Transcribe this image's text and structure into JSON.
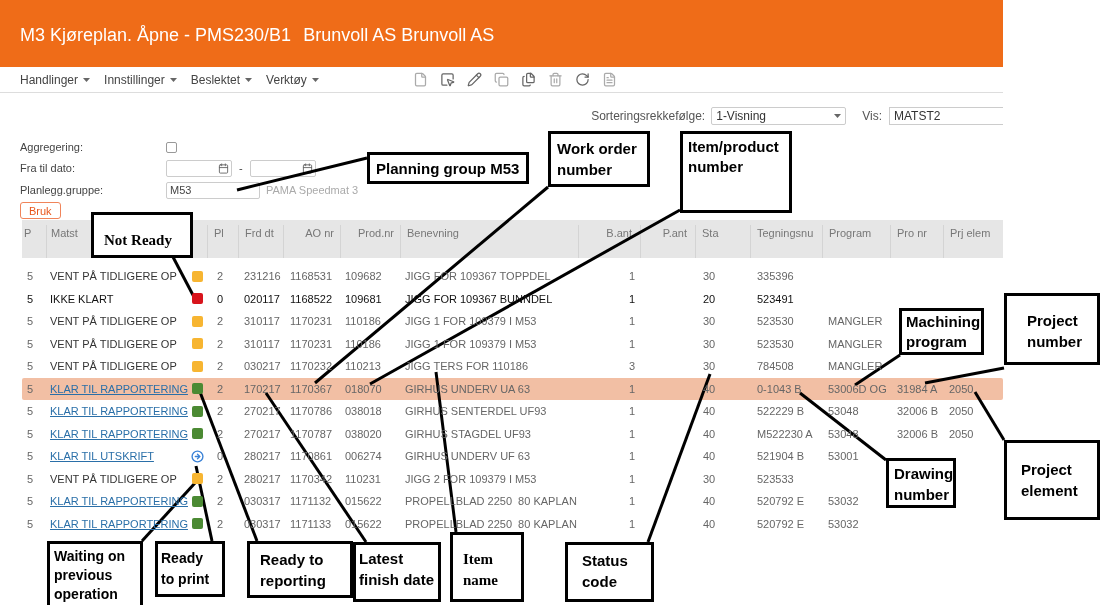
{
  "window": {
    "title": "M3 Kjøreplan. Åpne - PMS230/B1",
    "company": "Brunvoll AS Brunvoll AS"
  },
  "menu": [
    {
      "label": "Handlinger"
    },
    {
      "label": "Innstillinger"
    },
    {
      "label": "Beslektet"
    },
    {
      "label": "Verktøy"
    }
  ],
  "sort": {
    "label": "Sorteringsrekkefølge:",
    "value": "1-Visning"
  },
  "view": {
    "label": "Vis:",
    "value": "MATST2"
  },
  "filters": {
    "aggregation": {
      "label": "Aggregering:",
      "checked": false
    },
    "date_range": {
      "label": "Fra til dato:",
      "separator": "-"
    },
    "planning_group": {
      "label": "Planlegg.gruppe:",
      "value": "M53",
      "description": "PAMA Speedmat 3"
    }
  },
  "apply_button": "Bruk",
  "table": {
    "columns": [
      "P",
      "Matst",
      "Pl",
      "Frd dt",
      "AO nr",
      "Prod.nr",
      "Benevning",
      "B.ant",
      "P.ant",
      "Sta",
      "Tegningsnu",
      "Program",
      "Pro nr",
      "Prj elem"
    ],
    "rows": [
      {
        "p": "5",
        "matst": "VENT PÅ TIDLIGERE OP",
        "link": false,
        "kind": "waiting",
        "pl": "2",
        "frd_dt": "231216",
        "ao_nr": "1168531",
        "prod_nr": "109682",
        "benevning": "JIGG FOR 109367 TOPPDEL",
        "b_ant": "1",
        "sta": "30",
        "tegningsnu": "335396",
        "selected": false,
        "emphasis": false
      },
      {
        "p": "5",
        "matst": "IKKE KLART",
        "link": false,
        "kind": "not_ready",
        "pl": "0",
        "frd_dt": "020117",
        "ao_nr": "1168522",
        "prod_nr": "109681",
        "benevning": "JIGG FOR 109367 BUNNDEL",
        "b_ant": "1",
        "sta": "20",
        "tegningsnu": "523491",
        "selected": false,
        "emphasis": true
      },
      {
        "p": "5",
        "matst": "VENT PÅ TIDLIGERE OP",
        "link": false,
        "kind": "waiting",
        "pl": "2",
        "frd_dt": "310117",
        "ao_nr": "1170231",
        "prod_nr": "110186",
        "benevning": "JIGG 1 FOR 109379 I M53",
        "b_ant": "1",
        "sta": "30",
        "tegningsnu": "523530",
        "program": "MANGLER",
        "selected": false,
        "emphasis": false
      },
      {
        "p": "5",
        "matst": "VENT PÅ TIDLIGERE OP",
        "link": false,
        "kind": "waiting",
        "pl": "2",
        "frd_dt": "310117",
        "ao_nr": "1170231",
        "prod_nr": "110186",
        "benevning": "JIGG 1 FOR 109379 I M53",
        "b_ant": "1",
        "sta": "30",
        "tegningsnu": "523530",
        "program": "MANGLER",
        "selected": false,
        "emphasis": false
      },
      {
        "p": "5",
        "matst": "VENT PÅ TIDLIGERE OP",
        "link": false,
        "kind": "waiting",
        "pl": "2",
        "frd_dt": "030217",
        "ao_nr": "1170232",
        "prod_nr": "110213",
        "benevning": "JIGG TERS FOR 110186",
        "b_ant": "3",
        "sta": "30",
        "tegningsnu": "784508",
        "program": "MANGLER",
        "selected": false,
        "emphasis": false
      },
      {
        "p": "5",
        "matst": "KLAR TIL RAPPORTERING",
        "link": true,
        "kind": "ready_report",
        "pl": "2",
        "frd_dt": "170217",
        "ao_nr": "1170367",
        "prod_nr": "018070",
        "benevning": "GIRHUS UNDERV UA 63",
        "b_ant": "1",
        "sta": "40",
        "tegningsnu": "0-1043 B",
        "program": "53006D OG",
        "pro_nr": "31984 A",
        "prj_elem": "2050",
        "selected": true,
        "emphasis": false
      },
      {
        "p": "5",
        "matst": "KLAR TIL RAPPORTERING",
        "link": true,
        "kind": "ready_report",
        "pl": "2",
        "frd_dt": "270217",
        "ao_nr": "1170786",
        "prod_nr": "038018",
        "benevning": "GIRHUS SENTERDEL UF93",
        "b_ant": "1",
        "sta": "40",
        "tegningsnu": "522229 B",
        "program": "53048",
        "pro_nr": "32006 B",
        "prj_elem": "2050",
        "selected": false,
        "emphasis": false
      },
      {
        "p": "5",
        "matst": "KLAR TIL RAPPORTERING",
        "link": true,
        "kind": "ready_report",
        "pl": "2",
        "frd_dt": "270217",
        "ao_nr": "1170787",
        "prod_nr": "038020",
        "benevning": "GIRHUS STAGDEL UF93",
        "b_ant": "1",
        "sta": "40",
        "tegningsnu": "M522230 A",
        "program": "53048",
        "pro_nr": "32006 B",
        "prj_elem": "2050",
        "selected": false,
        "emphasis": false
      },
      {
        "p": "5",
        "matst": "KLAR TIL UTSKRIFT",
        "link": true,
        "kind": "ready_print",
        "pl": "0",
        "frd_dt": "280217",
        "ao_nr": "1170861",
        "prod_nr": "006274",
        "benevning": "GIRHUS UNDERV UF 63",
        "b_ant": "1",
        "sta": "40",
        "tegningsnu": "521904 B",
        "program": "53001",
        "selected": false,
        "emphasis": false
      },
      {
        "p": "5",
        "matst": "VENT PÅ TIDLIGERE OP",
        "link": false,
        "kind": "waiting",
        "pl": "2",
        "frd_dt": "280217",
        "ao_nr": "1170342",
        "prod_nr": "110231",
        "benevning": "JIGG 2 FOR 109379 I M53",
        "b_ant": "1",
        "sta": "30",
        "tegningsnu": "523533",
        "selected": false,
        "emphasis": false
      },
      {
        "p": "5",
        "matst": "KLAR TIL RAPPORTERING",
        "link": true,
        "kind": "ready_report",
        "pl": "2",
        "frd_dt": "030317",
        "ao_nr": "1171132",
        "prod_nr": "015622",
        "benevning": "PROPELLBLAD 2250  80 KAPLAN",
        "b_ant": "1",
        "sta": "40",
        "tegningsnu": "520792 E",
        "program": "53032",
        "selected": false,
        "emphasis": false
      },
      {
        "p": "5",
        "matst": "KLAR TIL RAPPORTERING",
        "link": true,
        "kind": "ready_report",
        "pl": "2",
        "frd_dt": "030317",
        "ao_nr": "1171133",
        "prod_nr": "015622",
        "benevning": "PROPELLBLAD 2250  80 KAPLAN",
        "b_ant": "1",
        "sta": "40",
        "tegningsnu": "520792 E",
        "program": "53032",
        "selected": false,
        "emphasis": false
      }
    ]
  },
  "annotations": [
    {
      "text": "Planning group M53"
    },
    {
      "text": "Not Ready"
    },
    {
      "text": "Work order number"
    },
    {
      "text": "Item/product number"
    },
    {
      "text": "Machining program"
    },
    {
      "text": "Project number"
    },
    {
      "text": "Drawing number"
    },
    {
      "text": "Project element"
    },
    {
      "text": "Waiting on previous operation"
    },
    {
      "text": "Ready to print"
    },
    {
      "text": "Ready to reporting"
    },
    {
      "text": "Latest finish date"
    },
    {
      "text": "Item name"
    },
    {
      "text": "Status code"
    }
  ]
}
